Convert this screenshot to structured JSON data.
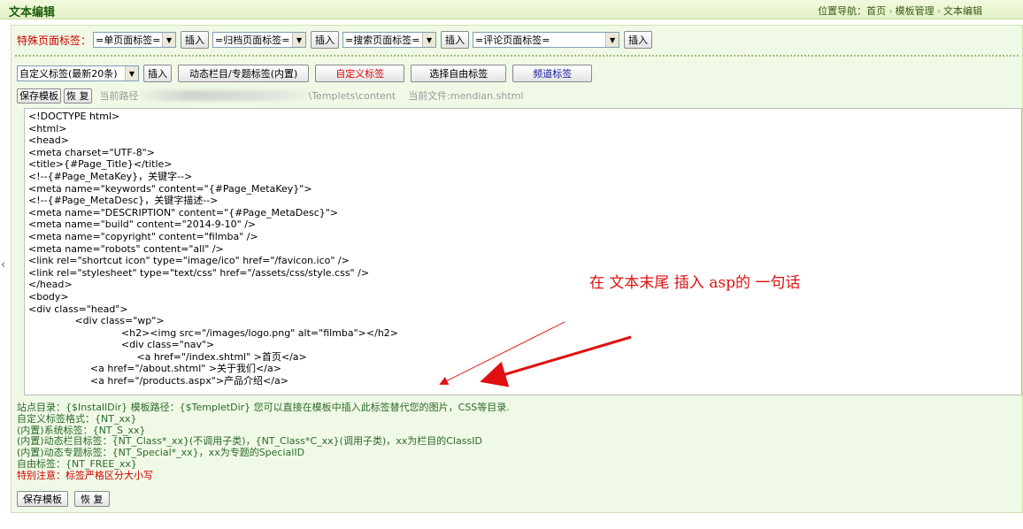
{
  "header": {
    "title": "文本编辑",
    "breadcrumb": [
      "位置导航：首页",
      "模板管理",
      "文本编辑"
    ]
  },
  "special_tags": {
    "label": "特殊页面标签：",
    "selects": [
      "=单页面标签=",
      "=归档页面标签=",
      "=搜索页面标签=",
      "=评论页面标签="
    ],
    "insert_label": "插入"
  },
  "tag_toolbar": {
    "custom_select": "自定义标签(最新20条)",
    "insert_label": "插入",
    "dynamic_label": "动态栏目/专题标签(内置)",
    "custom_label": "自定义标签",
    "free_label": "选择自由标签",
    "channel_label": "频道标签"
  },
  "file_bar": {
    "save_label": "保存模板",
    "restore_label": "恢 复",
    "path_prefix": "当前路径",
    "path_suffix": "\\Templets\\content",
    "current_file": "当前文件:mendian.shtml"
  },
  "editor": {
    "content": "<!DOCTYPE html>\n<html>\n<head>\n<meta charset=\"UTF-8\">\n<title>{#Page_Title}</title>\n<!--{#Page_MetaKey}，关键字-->\n<meta name=\"keywords\" content=\"{#Page_MetaKey}\">\n<!--{#Page_MetaDesc}，关键字描述-->\n<meta name=\"DESCRIPTION\" content=\"{#Page_MetaDesc}\">\n<meta name=\"build\" content=\"2014-9-10\" />\n<meta name=\"copyright\" content=\"filmba\" />\n<meta name=\"robots\" content=\"all\" />\n<link rel=\"shortcut icon\" type=\"image/ico\" href=\"/favicon.ico\" />\n<link rel=\"stylesheet\" type=\"text/css\" href=\"/assets/css/style.css\" />\n</head>\n<body>\n<div class=\"head\">\n               <div class=\"wp\">\n                              <h2><img src=\"/images/logo.png\" alt=\"filmba\"></h2>\n                              <div class=\"nav\">\n                                   <a href=\"/index.shtml\" >首页</a>\n                    <a href=\"/about.shtml\" >关于我们</a>\n                    <a href=\"/products.aspx\">产品介绍</a>",
    "annotation": "在  文本末尾  插入    asp的  一句话"
  },
  "info": {
    "lines": [
      "站点目录：{$InstallDir}  模板路径：{$TempletDir} 您可以直接在模板中插入此标签替代您的图片，CSS等目录.",
      "自定义标签格式：{NT_xx}",
      "(内置)系统标签：{NT_S_xx}",
      "(内置)动态栏目标签：{NT_Class*_xx}(不调用子类)，{NT_Class*C_xx}(调用子类)，xx为栏目的ClassID",
      "(内置)动态专题标签：{NT_Special*_xx}，xx为专题的SpecialID",
      "自由标签：{NT_FREE_xx}"
    ],
    "warning": "特别注意：标签严格区分大小写"
  },
  "bottom": {
    "save_label": "保存模板",
    "restore_label": "恢 复"
  },
  "colors": {
    "accent_red": "#e01010",
    "panel_green": "#f0f9e6",
    "title_green": "#1d5c0a"
  }
}
